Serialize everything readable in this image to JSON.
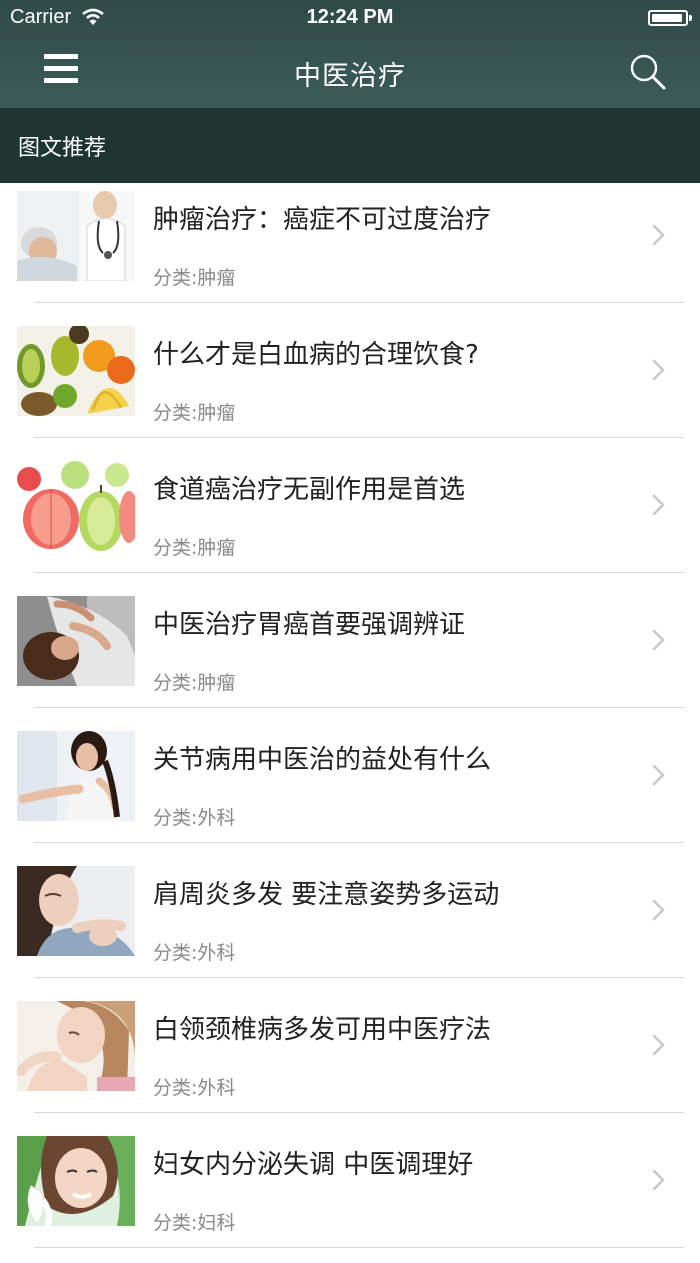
{
  "status_bar": {
    "carrier": "Carrier",
    "time": "12:24 PM",
    "battery_level": 0.95
  },
  "nav": {
    "title": "中医治疗",
    "menu_icon": "hamburger-menu-icon",
    "search_icon": "search-icon"
  },
  "section": {
    "title": "图文推荐"
  },
  "colors": {
    "nav_bg": "#3c5c58",
    "section_bg": "#1e3532",
    "separator": "#d8d8d8",
    "chevron": "#c7c7cc"
  },
  "articles": [
    {
      "title": "肿瘤治疗：癌症不可过度治疗",
      "category": "分类:肿瘤",
      "thumb": "doctor-patient-photo"
    },
    {
      "title": "什么才是白血病的合理饮食?",
      "category": "分类:肿瘤",
      "thumb": "fruits-photo"
    },
    {
      "title": "食道癌治疗无副作用是首选",
      "category": "分类:肿瘤",
      "thumb": "paper-fruits-photo"
    },
    {
      "title": "中医治疗胃癌首要强调辨证",
      "category": "分类:肿瘤",
      "thumb": "woman-stomach-pain-photo"
    },
    {
      "title": "关节病用中医治的益处有什么",
      "category": "分类:外科",
      "thumb": "woman-joint-pain-photo"
    },
    {
      "title": "肩周炎多发 要注意姿势多运动",
      "category": "分类:外科",
      "thumb": "woman-shoulder-photo"
    },
    {
      "title": "白领颈椎病多发可用中医疗法",
      "category": "分类:外科",
      "thumb": "woman-neck-photo"
    },
    {
      "title": "妇女内分泌失调 中医调理好",
      "category": "分类:妇科",
      "thumb": "woman-flowers-photo"
    }
  ]
}
